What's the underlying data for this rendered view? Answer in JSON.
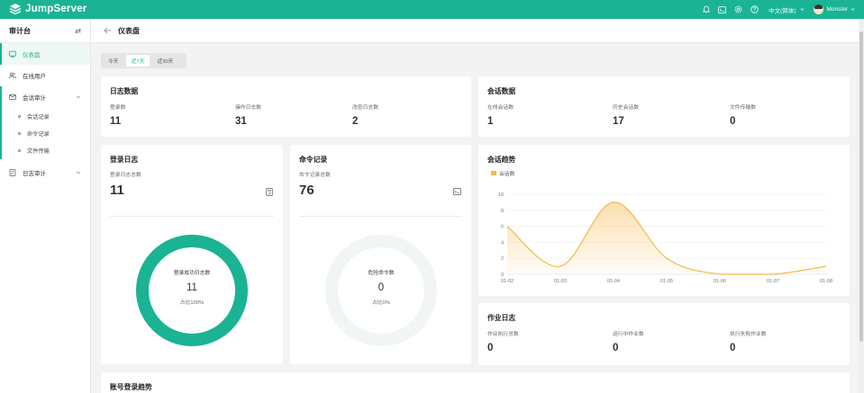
{
  "app": {
    "name": "JumpServer"
  },
  "topbar": {
    "icons": [
      "bell-icon",
      "terminal-icon",
      "settings-gear-icon",
      "help-icon"
    ],
    "language": "中文(简体)",
    "username": "Monster",
    "accent_color": "#1ab394"
  },
  "sidebar": {
    "title": "审计台",
    "items": [
      {
        "label": "仪表盘",
        "icon": "dashboard-icon",
        "active": true
      },
      {
        "label": "在线用户",
        "icon": "users-icon"
      },
      {
        "label": "会话审计",
        "icon": "session-audit-icon",
        "expanded": true
      },
      {
        "label": "会话记录"
      },
      {
        "label": "命令记录"
      },
      {
        "label": "文件传输"
      },
      {
        "label": "日志审计",
        "icon": "log-audit-icon",
        "expanded": false
      }
    ]
  },
  "page": {
    "title": "仪表盘"
  },
  "date_tabs": [
    {
      "label": "今天"
    },
    {
      "label": "近7天",
      "active": true
    },
    {
      "label": "近30天"
    }
  ],
  "log_data": {
    "title": "日志数据",
    "stats": [
      {
        "label": "登录数",
        "value": "11"
      },
      {
        "label": "操作日志数",
        "value": "31"
      },
      {
        "label": "改密日志数",
        "value": "2"
      }
    ]
  },
  "session_data": {
    "title": "会话数据",
    "stats": [
      {
        "label": "在线会话数",
        "value": "1"
      },
      {
        "label": "历史会话数",
        "value": "17"
      },
      {
        "label": "文件传输数",
        "value": "0"
      }
    ]
  },
  "login_log": {
    "title": "登录日志",
    "sub_label": "登录日志总数",
    "total": "11",
    "donut_label": "登录成功日志数",
    "donut_value": "11",
    "donut_pct": "占比100%",
    "fraction": 1.0,
    "color": "#1ab394"
  },
  "command_log": {
    "title": "命令记录",
    "sub_label": "命令记录总数",
    "total": "76",
    "donut_label": "危险命令数",
    "donut_value": "0",
    "donut_pct": "占比0%",
    "fraction": 0.0,
    "color": "#f1f5f3"
  },
  "session_trend": {
    "title": "会话趋势",
    "legend": "会话数",
    "color": "#f5b84a"
  },
  "job_log": {
    "title": "作业日志",
    "stats": [
      {
        "label": "作业执行总数",
        "value": "0"
      },
      {
        "label": "运行中作业数",
        "value": "0"
      },
      {
        "label": "执行失败作业数",
        "value": "0"
      }
    ]
  },
  "account_trend": {
    "title": "账号登录趋势"
  },
  "chart_data": {
    "type": "area",
    "title": "会话趋势",
    "series": [
      {
        "name": "会话数",
        "values": [
          6,
          1,
          9,
          2,
          0,
          0,
          1
        ]
      }
    ],
    "categories": [
      "01-02",
      "01-03",
      "01-04",
      "01-05",
      "01-06",
      "01-07",
      "01-08"
    ],
    "ylim": [
      0,
      10
    ],
    "yticks": [
      0,
      2,
      4,
      6,
      8,
      10
    ],
    "smooth": true,
    "grid": true,
    "legend_position": "top-left"
  }
}
